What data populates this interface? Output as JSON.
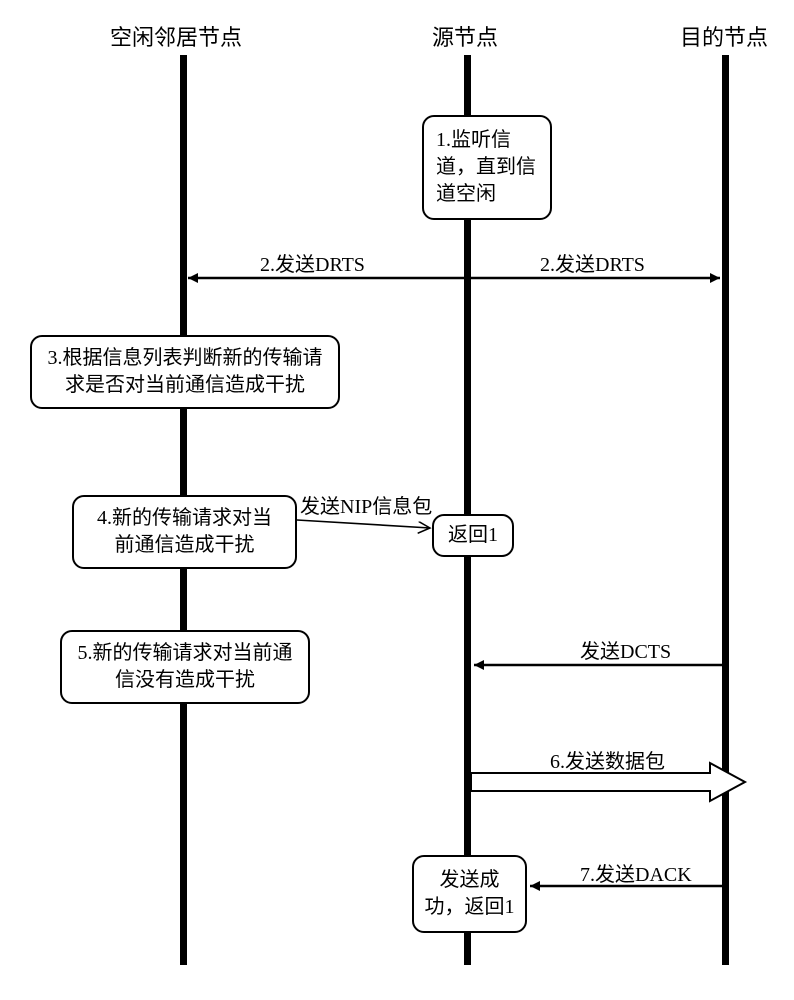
{
  "headers": {
    "idle": "空闲邻居节点",
    "source": "源节点",
    "dest": "目的节点"
  },
  "boxes": {
    "b1": "1.监听信道，直到信道空闲",
    "b3": "3.根据信息列表判断新的传输请求是否对当前通信造成干扰",
    "b4": "4.新的传输请求对当前通信造成干扰",
    "b4r": "返回1",
    "b5": "5.新的传输请求对当前通信没有造成干扰",
    "b8": "发送成功，返回1"
  },
  "arrows": {
    "a2l": "2.发送DRTS",
    "a2r": "2.发送DRTS",
    "nip": "发送NIP信息包",
    "dcts": "发送DCTS",
    "data": "6.发送数据包",
    "dack": "7.发送DACK"
  }
}
